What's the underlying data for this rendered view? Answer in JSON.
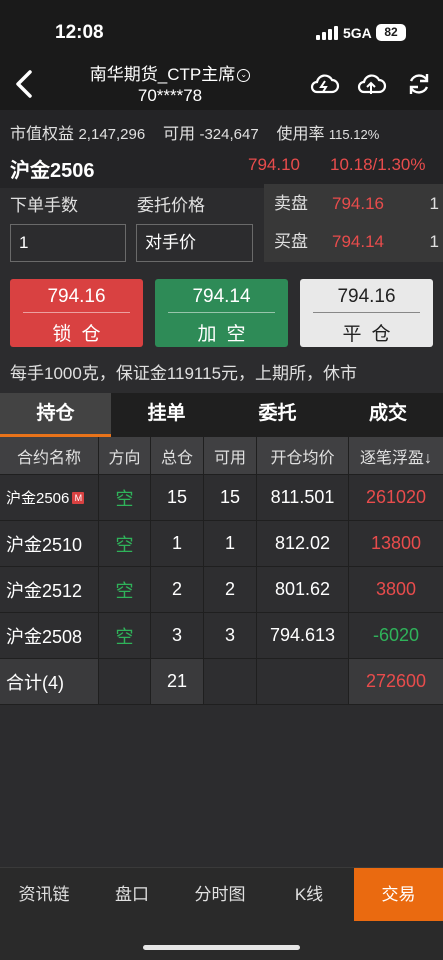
{
  "status_bar": {
    "time": "12:08",
    "network": "5GA",
    "battery": "82"
  },
  "header": {
    "title_line1": "南华期货_CTP主席",
    "title_line2": "70****78",
    "chevron_glyph": "⌄"
  },
  "summary": {
    "equity_label": "市值权益",
    "equity_value": "2,147,296",
    "available_label": "可用",
    "available_value": "-324,647",
    "usage_label": "使用率",
    "usage_value": "115.12%"
  },
  "contract": {
    "name": "沪金2506",
    "price": "794.10",
    "change": "10.18/1.30%"
  },
  "order_form": {
    "qty_label": "下单手数",
    "qty_value": "1",
    "price_label": "委托价格",
    "price_value": "对手价"
  },
  "order_book": {
    "ask_label": "卖盘",
    "ask_price": "794.16",
    "ask_qty": "1",
    "bid_label": "买盘",
    "bid_price": "794.14",
    "bid_qty": "1"
  },
  "actions": {
    "lock": {
      "price": "794.16",
      "label": "锁仓"
    },
    "short": {
      "price": "794.14",
      "label": "加空"
    },
    "close": {
      "price": "794.16",
      "label": "平仓"
    }
  },
  "contract_info": "每手1000克，保证金119115元，上期所，休市",
  "tabs": [
    "持仓",
    "挂单",
    "委托",
    "成交"
  ],
  "table": {
    "headers": [
      "合约名称",
      "方向",
      "总仓",
      "可用",
      "开仓均价",
      "逐笔浮盈↓"
    ],
    "rows": [
      {
        "name": "沪金2506",
        "badge": "M",
        "direction": "空",
        "total": "15",
        "available": "15",
        "avg_price": "811.501",
        "pnl": "261020"
      },
      {
        "name": "沪金2510",
        "badge": "",
        "direction": "空",
        "total": "1",
        "available": "1",
        "avg_price": "812.02",
        "pnl": "13800"
      },
      {
        "name": "沪金2512",
        "badge": "",
        "direction": "空",
        "total": "2",
        "available": "2",
        "avg_price": "801.62",
        "pnl": "3800"
      },
      {
        "name": "沪金2508",
        "badge": "",
        "direction": "空",
        "total": "3",
        "available": "3",
        "avg_price": "794.613",
        "pnl": "-6020"
      }
    ],
    "total": {
      "label": "合计(4)",
      "total": "21",
      "pnl": "272600"
    }
  },
  "bottom_nav": [
    "资讯链",
    "盘口",
    "分时图",
    "K线",
    "交易"
  ],
  "colors": {
    "up": "#e84c4c",
    "down": "#2fb35a",
    "accent": "#ea6a10",
    "background": "#2c2c2e"
  }
}
